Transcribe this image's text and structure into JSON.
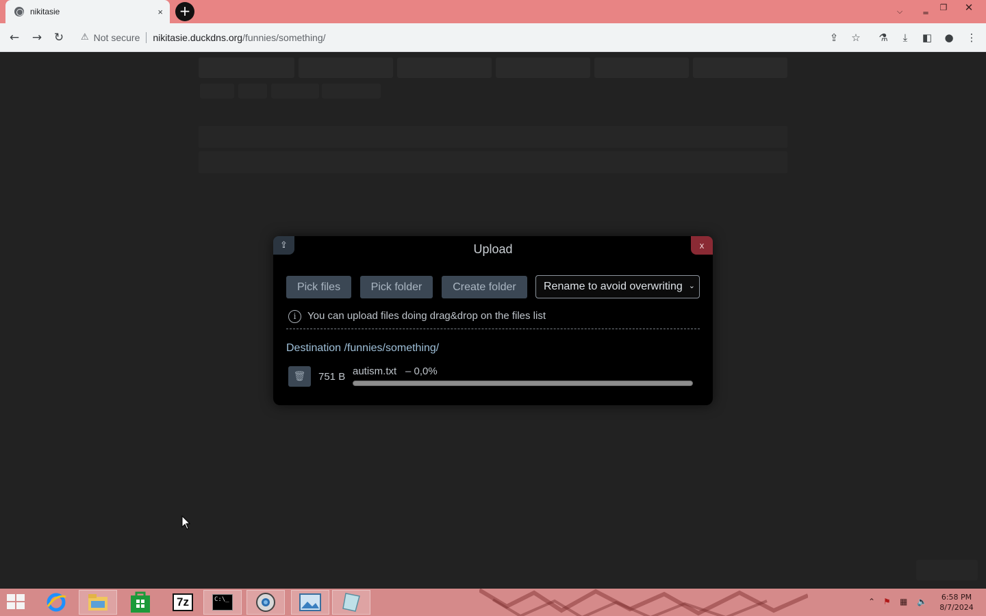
{
  "browser": {
    "tab_title": "nikitasie",
    "tab_close": "×",
    "new_tab": "+",
    "address": {
      "security_label": "Not secure",
      "host": "nikitasie.duckdns.org",
      "path": "/funnies/something/"
    }
  },
  "upload_dialog": {
    "title": "Upload",
    "close_label": "x",
    "pick_files_label": "Pick files",
    "pick_folder_label": "Pick folder",
    "create_folder_label": "Create folder",
    "conflict_option": "Rename to avoid overwriting",
    "info_text": "You can upload files doing drag&drop on the files list",
    "destination": "Destination /funnies/something/",
    "files": [
      {
        "size": "751 B",
        "name": "autism.txt",
        "progress_text": "– 0,0%",
        "progress": 0.0
      }
    ]
  },
  "taskbar": {
    "clock_time": "6:58 PM",
    "clock_date": "8/7/2024",
    "sevenzip_label": "7z"
  },
  "colors": {
    "tabstrip": "#e88484",
    "modal_close": "#8a2a34",
    "button": "#3b4754",
    "destination_text": "#9fc0d9",
    "taskbar": "#d58a8a"
  },
  "icons": [
    "globe-icon",
    "back-arrow-icon",
    "forward-arrow-icon",
    "reload-icon",
    "warning-icon",
    "share-icon",
    "star-icon",
    "flask-icon",
    "download-icon",
    "sidebar-icon",
    "profile-icon",
    "menu-dots-icon",
    "upload-icon",
    "info-icon",
    "trash-icon",
    "windows-start-icon",
    "internet-explorer-icon",
    "file-explorer-icon",
    "store-icon",
    "7zip-icon",
    "terminal-icon",
    "browser-icon",
    "photos-icon",
    "notepad-icon"
  ]
}
